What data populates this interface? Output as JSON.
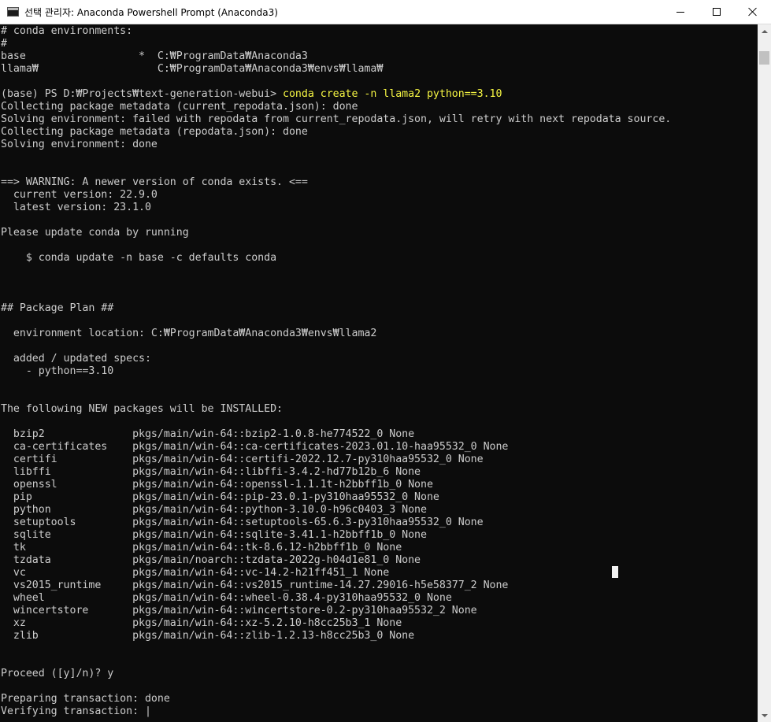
{
  "window": {
    "title": "선택 관리자: Anaconda Powershell Prompt (Anaconda3)"
  },
  "console": {
    "lines": [
      "# conda environments:",
      "#",
      "base                  *  C:₩ProgramData₩Anaconda3",
      "llama₩                   C:₩ProgramData₩Anaconda3₩envs₩llama₩",
      "",
      "(base) PS D:₩Projects₩text-generation-webui> ",
      "Collecting package metadata (current_repodata.json): done",
      "Solving environment: failed with repodata from current_repodata.json, will retry with next repodata source.",
      "Collecting package metadata (repodata.json): done",
      "Solving environment: done",
      "",
      "",
      "==> WARNING: A newer version of conda exists. <==",
      "  current version: 22.9.0",
      "  latest version: 23.1.0",
      "",
      "Please update conda by running",
      "",
      "    $ conda update -n base -c defaults conda",
      "",
      "",
      "",
      "## Package Plan ##",
      "",
      "  environment location: C:₩ProgramData₩Anaconda3₩envs₩llama2",
      "",
      "  added / updated specs:",
      "    - python==3.10",
      "",
      "",
      "The following NEW packages will be INSTALLED:",
      "",
      "  bzip2              pkgs/main/win-64::bzip2-1.0.8-he774522_0 None",
      "  ca-certificates    pkgs/main/win-64::ca-certificates-2023.01.10-haa95532_0 None",
      "  certifi            pkgs/main/win-64::certifi-2022.12.7-py310haa95532_0 None",
      "  libffi             pkgs/main/win-64::libffi-3.4.2-hd77b12b_6 None",
      "  openssl            pkgs/main/win-64::openssl-1.1.1t-h2bbff1b_0 None",
      "  pip                pkgs/main/win-64::pip-23.0.1-py310haa95532_0 None",
      "  python             pkgs/main/win-64::python-3.10.0-h96c0403_3 None",
      "  setuptools         pkgs/main/win-64::setuptools-65.6.3-py310haa95532_0 None",
      "  sqlite             pkgs/main/win-64::sqlite-3.41.1-h2bbff1b_0 None",
      "  tk                 pkgs/main/win-64::tk-8.6.12-h2bbff1b_0 None",
      "  tzdata             pkgs/main/noarch::tzdata-2022g-h04d1e81_0 None",
      "  vc                 pkgs/main/win-64::vc-14.2-h21ff451_1 None",
      "  vs2015_runtime     pkgs/main/win-64::vs2015_runtime-14.27.29016-h5e58377_2 None",
      "  wheel              pkgs/main/win-64::wheel-0.38.4-py310haa95532_0 None",
      "  wincertstore       pkgs/main/win-64::wincertstore-0.2-py310haa95532_2 None",
      "  xz                 pkgs/main/win-64::xz-5.2.10-h8cc25b3_1 None",
      "  zlib               pkgs/main/win-64::zlib-1.2.13-h8cc25b3_0 None",
      "",
      "",
      "Proceed ([y]/n)? y",
      "",
      "Preparing transaction: done",
      "Verifying transaction: |"
    ],
    "command_text": "conda create -n llama2 python==3.10"
  },
  "colors": {
    "background": "#0c0c0c",
    "text": "#cccccc",
    "command": "#f5f543",
    "titlebar": "#ffffff",
    "scrollbar": "#f0f0f0"
  },
  "icons": {
    "app": "console-window-icon",
    "minimize": "minimize-icon",
    "maximize": "maximize-icon",
    "close": "close-icon"
  }
}
